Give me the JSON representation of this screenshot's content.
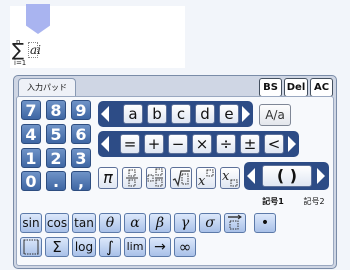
{
  "editor": {
    "sum_upper": "n",
    "sum_symbol": "∑",
    "sum_body": "ai",
    "sum_lower": "i=1"
  },
  "tab": {
    "label": "入力パッド"
  },
  "toolbar": {
    "bs": "BS",
    "del": "Del",
    "ac": "AC"
  },
  "numpad": [
    "7",
    "8",
    "9",
    "4",
    "5",
    "6",
    "1",
    "2",
    "3",
    "0",
    ".",
    ","
  ],
  "letters": [
    "a",
    "b",
    "c",
    "d",
    "e"
  ],
  "case_toggle": "A/a",
  "operators": [
    "=",
    "+",
    "−",
    "×",
    "÷",
    "±",
    "<"
  ],
  "templates": {
    "pi": "π"
  },
  "paren": "( )",
  "symbol_tabs": [
    "記号1",
    "記号2"
  ],
  "functions_row1": [
    "sin",
    "cos",
    "tan",
    "θ",
    "α",
    "β",
    "γ",
    "σ"
  ],
  "functions_row2": [
    "Σ",
    "log",
    "∫",
    "lim",
    "→",
    "∞"
  ]
}
